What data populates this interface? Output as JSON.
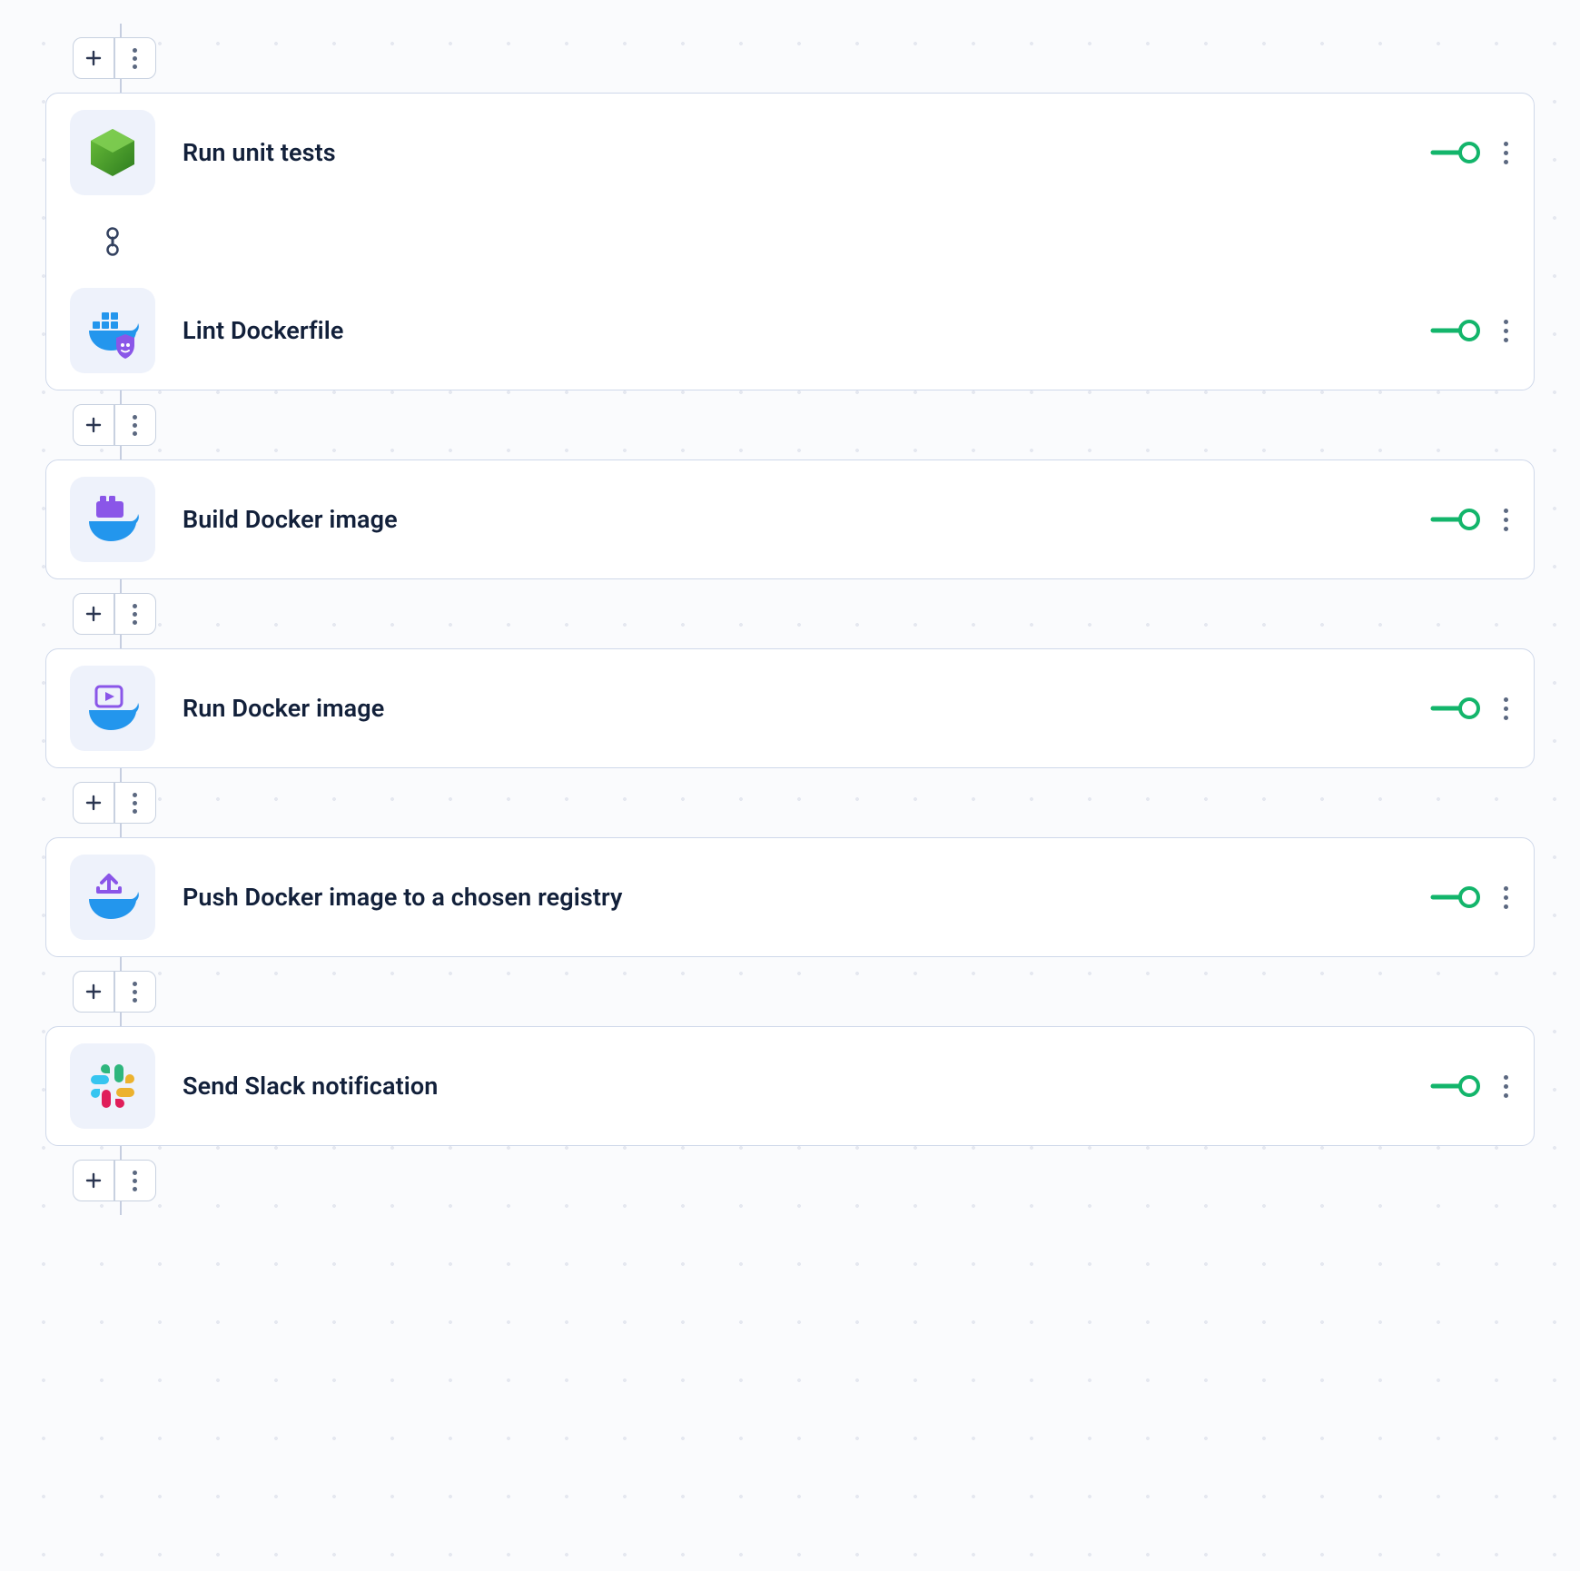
{
  "pipeline": {
    "stages": [
      {
        "steps": [
          {
            "label": "Run unit tests",
            "icon": "node",
            "enabled": true
          },
          {
            "label": "Lint Dockerfile",
            "icon": "docker-lint",
            "enabled": true
          }
        ]
      },
      {
        "steps": [
          {
            "label": "Build Docker image",
            "icon": "docker-build",
            "enabled": true
          }
        ]
      },
      {
        "steps": [
          {
            "label": "Run Docker image",
            "icon": "docker-run",
            "enabled": true
          }
        ]
      },
      {
        "steps": [
          {
            "label": "Push Docker image to a chosen registry",
            "icon": "docker-push",
            "enabled": true
          }
        ]
      },
      {
        "steps": [
          {
            "label": "Send Slack notification",
            "icon": "slack",
            "enabled": true
          }
        ]
      }
    ]
  }
}
